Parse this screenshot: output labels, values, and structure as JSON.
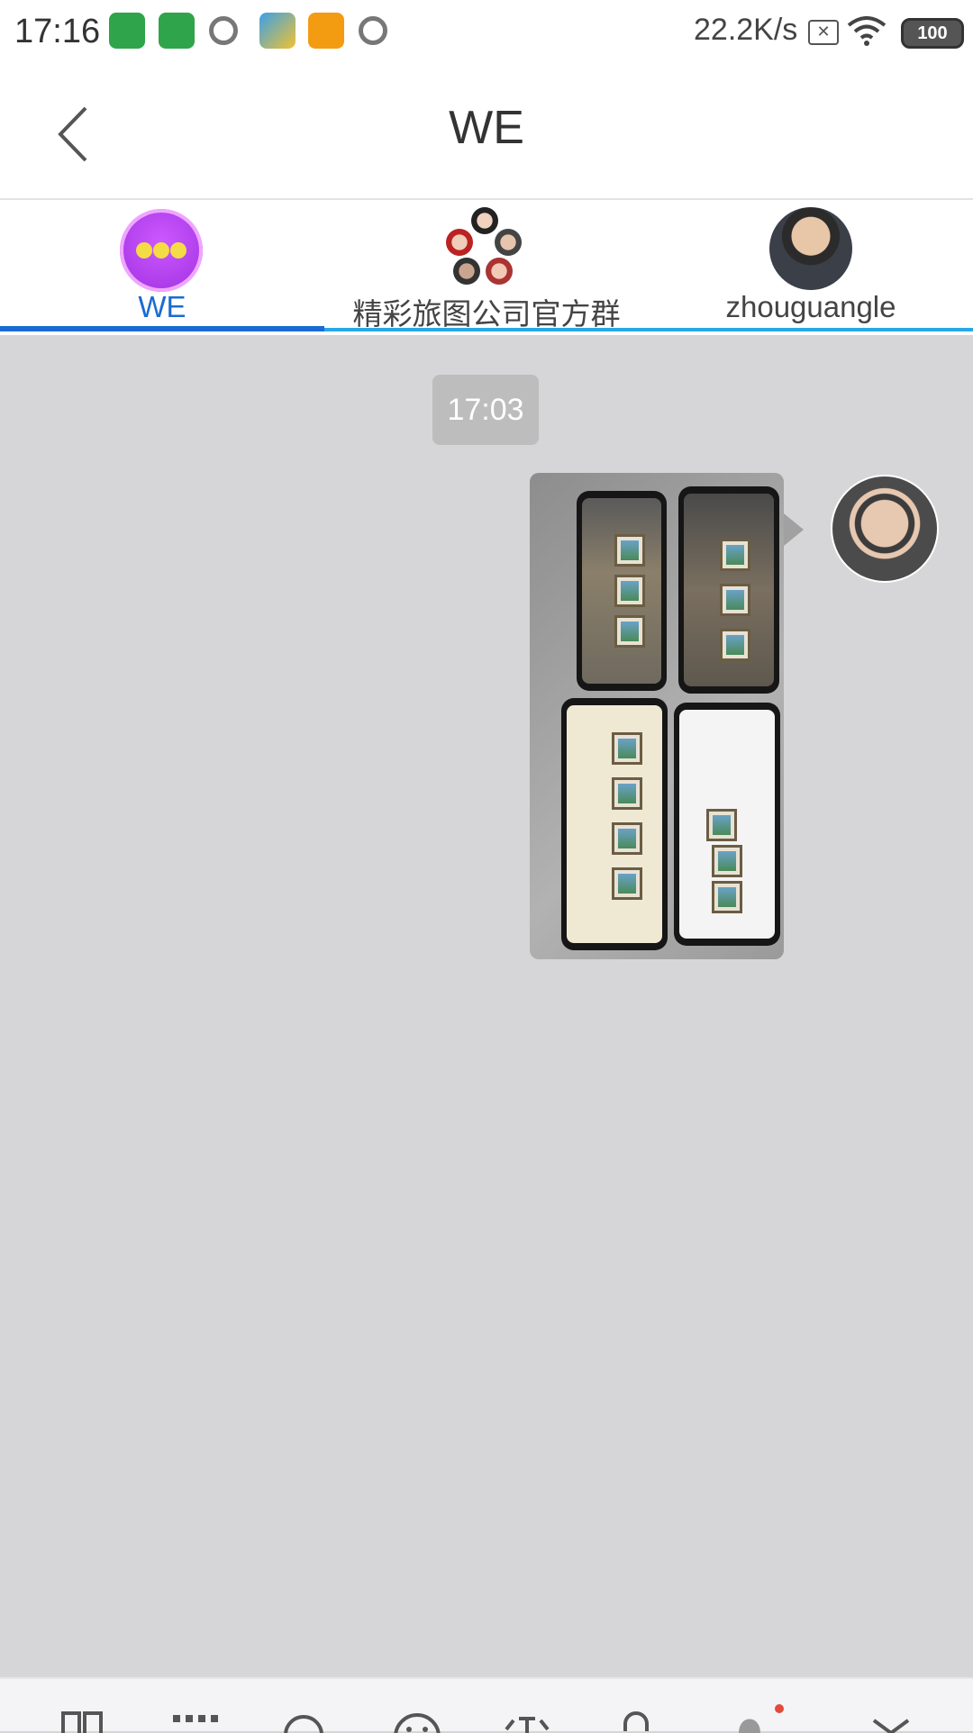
{
  "status_bar": {
    "time": "17:16",
    "network_speed": "22.2K/s",
    "battery": "100"
  },
  "header": {
    "title": "WE"
  },
  "tabs": [
    {
      "label": "WE",
      "active": true
    },
    {
      "label": "精彩旅图公司官方群",
      "active": false
    },
    {
      "label": "zhouguangle",
      "active": false
    }
  ],
  "chat": {
    "timestamp": "17:03"
  },
  "colors": {
    "accent": "#1a6bd1",
    "chat_background": "#d6d6d8"
  }
}
